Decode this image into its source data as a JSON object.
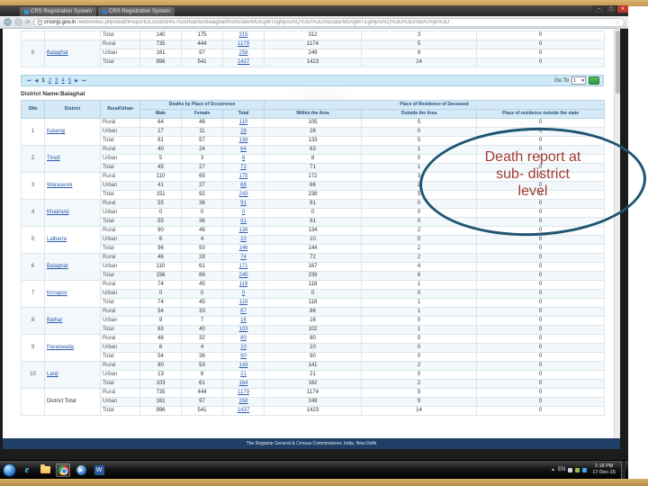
{
  "icons": {
    "minimize": "–",
    "maximize": "▢",
    "close": "✕",
    "back": "←",
    "forward": "→",
    "reload": "⟳",
    "star": "☆",
    "first": "⏮",
    "prev": "◀",
    "next": "▶",
    "last": "⏭",
    "dropdown": "▾",
    "tray_up": "▲",
    "word": "W",
    "ie": "e",
    "play": "▶"
  },
  "browser": {
    "tabs": [
      {
        "label": "CRS Registration System"
      },
      {
        "label": "CRS Registration System"
      }
    ],
    "url_domain": "crsorgi.gov.in",
    "url_path": "/web/index.php/deathReportDL/DistId/457/DistName/Balaghat/fromDate/MDEgMTAgMjAxNQ%3D%3D/toDate/MzAgMTEgMjAxNQ%3D%3D/rbd/c/h/jk%3D"
  },
  "top_table": {
    "groups": [
      {
        "sno": "",
        "name": "",
        "link": false,
        "rows": [
          {
            "area": "Total",
            "v": [
              140,
              175,
              315,
              312,
              3,
              0
            ]
          }
        ]
      },
      {
        "sno": "5",
        "name": "Balaghat",
        "link": true,
        "rows": [
          {
            "area": "Rural",
            "v": [
              735,
              444,
              1179,
              1174,
              5,
              0
            ]
          },
          {
            "area": "Urban",
            "v": [
              161,
              97,
              258,
              249,
              9,
              0
            ]
          },
          {
            "area": "Total",
            "v": [
              896,
              541,
              1437,
              1423,
              14,
              0
            ]
          }
        ]
      }
    ]
  },
  "pagination": {
    "pages": [
      "1",
      "2",
      "3",
      "4",
      "5"
    ],
    "current": "1",
    "goto_label": "Go To",
    "goto_value": "1"
  },
  "report": {
    "district_label": "District Name:Balaghat",
    "headers": {
      "sno": "SNo",
      "district": "District",
      "rural_urban": "Rural/Urban",
      "group_occurrence": "Deaths by Place of Occurrence",
      "group_residence": "Place of Residence of Deceased",
      "male": "Male",
      "female": "Female",
      "total": "Total",
      "within": "Within the Area",
      "outside": "Outside the Area",
      "outside_state": "Place of residence outside the state"
    },
    "groups": [
      {
        "sno": "1",
        "name": "Katangi",
        "link": true,
        "rows": [
          {
            "area": "Rural",
            "v": [
              64,
              46,
              110,
              105,
              5,
              0
            ]
          },
          {
            "area": "Urban",
            "v": [
              17,
              11,
              28,
              28,
              0,
              0
            ]
          },
          {
            "area": "Total",
            "v": [
              81,
              57,
              138,
              133,
              5,
              0
            ]
          }
        ]
      },
      {
        "sno": "2",
        "name": "Tirodi",
        "link": true,
        "rows": [
          {
            "area": "Rural",
            "v": [
              40,
              24,
              64,
              63,
              1,
              0
            ]
          },
          {
            "area": "Urban",
            "v": [
              5,
              3,
              8,
              8,
              0,
              0
            ]
          },
          {
            "area": "Total",
            "v": [
              45,
              27,
              72,
              71,
              1,
              0
            ]
          }
        ]
      },
      {
        "sno": "3",
        "name": "Waraseoni",
        "link": true,
        "rows": [
          {
            "area": "Rural",
            "v": [
              110,
              65,
              175,
              172,
              3,
              0
            ]
          },
          {
            "area": "Urban",
            "v": [
              41,
              27,
              68,
              66,
              2,
              0
            ]
          },
          {
            "area": "Total",
            "v": [
              151,
              92,
              243,
              238,
              5,
              0
            ]
          }
        ]
      },
      {
        "sno": "4",
        "name": "Khairlanji",
        "link": true,
        "rows": [
          {
            "area": "Rural",
            "v": [
              55,
              36,
              91,
              91,
              0,
              0
            ]
          },
          {
            "area": "Urban",
            "v": [
              0,
              0,
              0,
              0,
              0,
              0
            ]
          },
          {
            "area": "Total",
            "v": [
              55,
              36,
              91,
              91,
              0,
              0
            ]
          }
        ]
      },
      {
        "sno": "5",
        "name": "Lalbarra",
        "link": true,
        "rows": [
          {
            "area": "Rural",
            "v": [
              90,
              46,
              136,
              134,
              2,
              0
            ]
          },
          {
            "area": "Urban",
            "v": [
              6,
              4,
              10,
              10,
              0,
              0
            ]
          },
          {
            "area": "Total",
            "v": [
              96,
              50,
              146,
              144,
              2,
              0
            ]
          }
        ]
      },
      {
        "sno": "6",
        "name": "Balaghat",
        "link": true,
        "rows": [
          {
            "area": "Rural",
            "v": [
              46,
              28,
              74,
              72,
              2,
              0
            ]
          },
          {
            "area": "Urban",
            "v": [
              110,
              61,
              171,
              167,
              4,
              0
            ]
          },
          {
            "area": "Total",
            "v": [
              156,
              89,
              245,
              239,
              6,
              0
            ]
          }
        ]
      },
      {
        "sno": "7",
        "name": "Kirnapur",
        "link": true,
        "rows": [
          {
            "area": "Rural",
            "v": [
              74,
              45,
              119,
              118,
              1,
              0
            ]
          },
          {
            "area": "Urban",
            "v": [
              0,
              0,
              0,
              0,
              0,
              0
            ]
          },
          {
            "area": "Total",
            "v": [
              74,
              45,
              119,
              118,
              1,
              0
            ]
          }
        ]
      },
      {
        "sno": "8",
        "name": "Baihar",
        "link": true,
        "rows": [
          {
            "area": "Rural",
            "v": [
              54,
              33,
              87,
              86,
              1,
              0
            ]
          },
          {
            "area": "Urban",
            "v": [
              9,
              7,
              16,
              16,
              0,
              0
            ]
          },
          {
            "area": "Total",
            "v": [
              63,
              40,
              103,
              102,
              1,
              0
            ]
          }
        ]
      },
      {
        "sno": "9",
        "name": "Paraswada",
        "link": true,
        "rows": [
          {
            "area": "Rural",
            "v": [
              48,
              32,
              80,
              80,
              0,
              0
            ]
          },
          {
            "area": "Urban",
            "v": [
              6,
              4,
              10,
              10,
              0,
              0
            ]
          },
          {
            "area": "Total",
            "v": [
              54,
              36,
              90,
              90,
              0,
              0
            ]
          }
        ]
      },
      {
        "sno": "10",
        "name": "Lanji",
        "link": true,
        "rows": [
          {
            "area": "Rural",
            "v": [
              90,
              53,
              143,
              141,
              2,
              0
            ]
          },
          {
            "area": "Urban",
            "v": [
              13,
              8,
              21,
              21,
              0,
              0
            ]
          },
          {
            "area": "Total",
            "v": [
              103,
              61,
              164,
              162,
              2,
              0
            ]
          }
        ]
      },
      {
        "sno": "",
        "name": "District Total",
        "link": false,
        "rows": [
          {
            "area": "Rural",
            "v": [
              735,
              444,
              1179,
              1174,
              5,
              0
            ]
          },
          {
            "area": "Urban",
            "v": [
              161,
              97,
              258,
              249,
              9,
              0
            ]
          },
          {
            "area": "Total",
            "v": [
              896,
              541,
              1437,
              1423,
              14,
              0
            ]
          }
        ]
      }
    ]
  },
  "page_footer": {
    "text": "The Registrar General & Census Commissioner, India, New Delhi"
  },
  "taskbar": {
    "lang": "EN",
    "time": "1:18 PM",
    "date": "17-Dec-15"
  },
  "annotation": {
    "lines": [
      "Death report at",
      "sub- district",
      "level"
    ]
  }
}
